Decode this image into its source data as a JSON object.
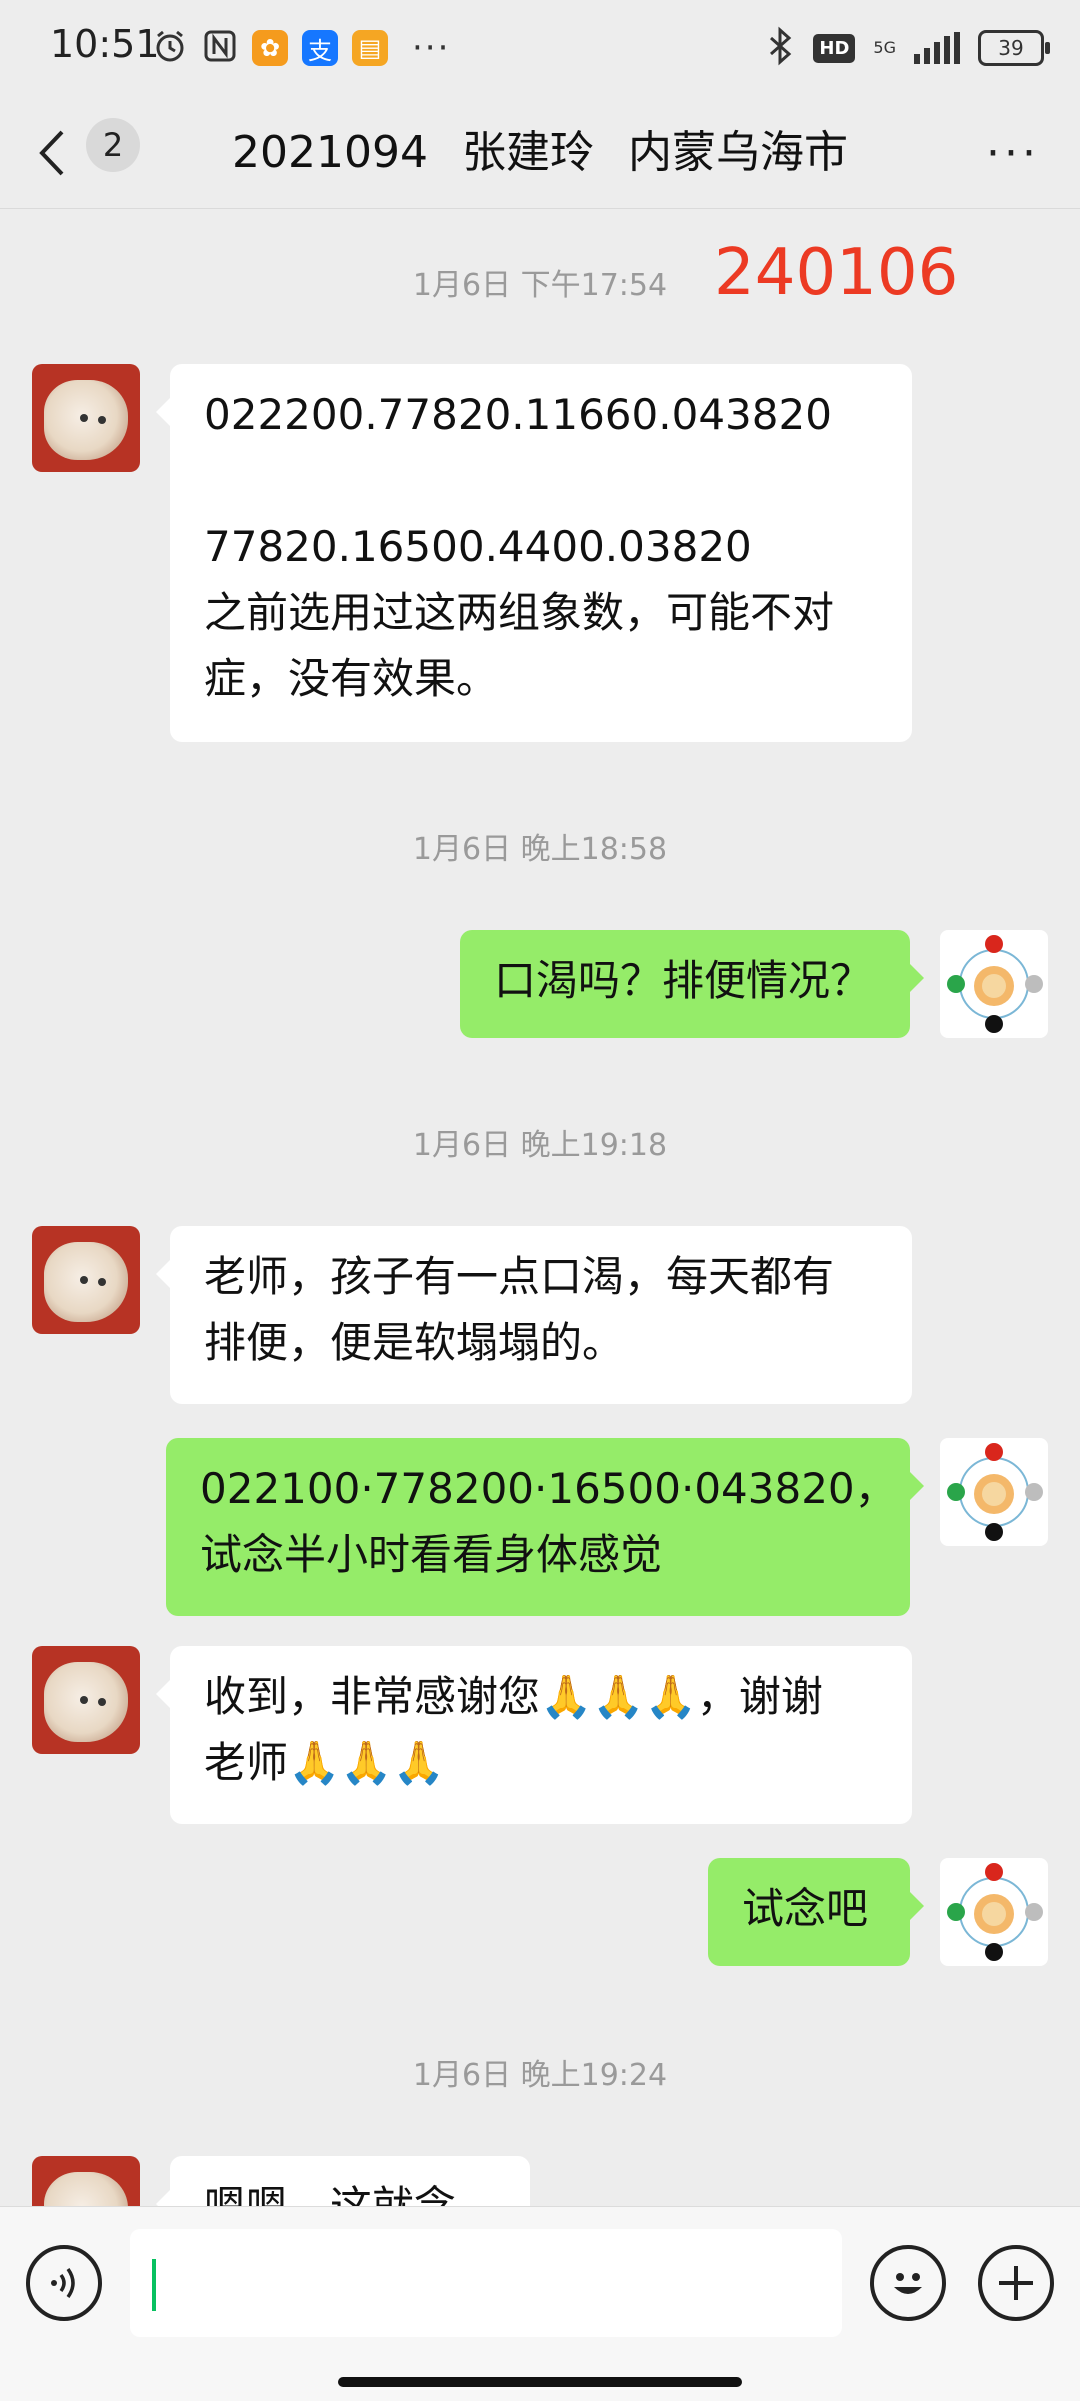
{
  "status_bar": {
    "time": "10:51",
    "net_label": "5G",
    "hd_label": "HD",
    "battery": "39",
    "more": "···",
    "icons": [
      "alarm-icon",
      "nfc-icon",
      "taobao-icon",
      "alipay-icon",
      "notes-icon",
      "bluetooth-icon",
      "signal-icon"
    ]
  },
  "header": {
    "unread_count": "2",
    "title_parts": [
      "2021094",
      "张建玲",
      "内蒙乌海市"
    ],
    "menu": "···"
  },
  "colors": {
    "bubble_out": "#95ec69",
    "bubble_in": "#ffffff",
    "stamp_red": "#ec3a23",
    "background": "#ededed"
  },
  "messages": {
    "ts1": "1月6日 下午17:54",
    "stamp": "240106",
    "m1_line1": "022200.77820.11660.043820",
    "m1_line2": "77820.16500.4400.03820",
    "m1_line3": "之前选用过这两组象数，可能不对",
    "m1_line4": "症，没有效果。",
    "ts2": "1月6日 晚上18:58",
    "m2": "口渴吗？排便情况？",
    "ts3": "1月6日 晚上19:18",
    "m3_line1": "老师，孩子有一点口渴，每天都有",
    "m3_line2": "排便，便是软塌塌的。",
    "m4_line1": "022100·778200·16500·043820，",
    "m4_line2": "试念半小时看看身体感觉",
    "m5_line1": "收到，非常感谢您🙏🙏🙏，谢谢",
    "m5_line2": "老师🙏🙏🙏",
    "m6": "试念吧",
    "ts4": "1月6日 晚上19:24",
    "m7_partial": "嗯嗯，这就念"
  }
}
